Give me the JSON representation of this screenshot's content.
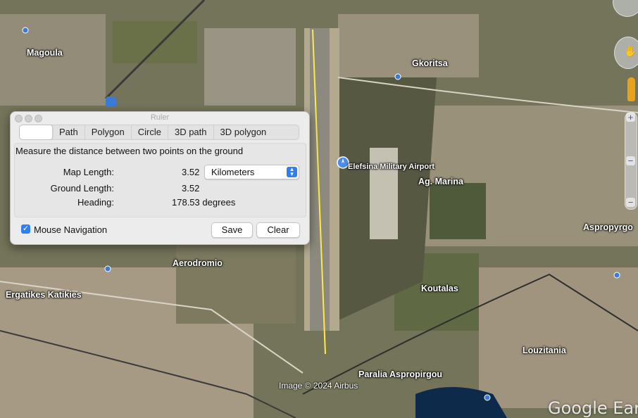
{
  "map": {
    "places": [
      {
        "name": "Magoula"
      },
      {
        "name": "Gkoritsa"
      },
      {
        "name": "Elefsina Military Airport"
      },
      {
        "name": "Ag. Marina"
      },
      {
        "name": "Aspropyrgo"
      },
      {
        "name": "Aerodromio"
      },
      {
        "name": "Ergatikes Katikies"
      },
      {
        "name": "Koutalas"
      },
      {
        "name": "Louzitania"
      },
      {
        "name": "Paralia Aspropirgou"
      }
    ],
    "credit": "Image © 2024 Airbus",
    "brand": "Google Ear",
    "ruler_line_color": "#ffe94a"
  },
  "ruler": {
    "window_title": "Ruler",
    "tabs": [
      {
        "label": ""
      },
      {
        "label": "Path"
      },
      {
        "label": "Polygon"
      },
      {
        "label": "Circle"
      },
      {
        "label": "3D path"
      },
      {
        "label": "3D polygon"
      }
    ],
    "description": "Measure the distance between two points on the ground",
    "map_length_label": "Map Length:",
    "map_length_value": "3.52",
    "unit": "Kilometers",
    "ground_length_label": "Ground Length:",
    "ground_length_value": "3.52",
    "heading_label": "Heading:",
    "heading_value": "178.53 degrees",
    "mouse_navigation_label": "Mouse Navigation",
    "mouse_navigation_checked": true,
    "save_label": "Save",
    "clear_label": "Clear",
    "accent": "#2f7ef6"
  },
  "nav": {
    "zoom_in": "+",
    "zoom_out": "−"
  }
}
